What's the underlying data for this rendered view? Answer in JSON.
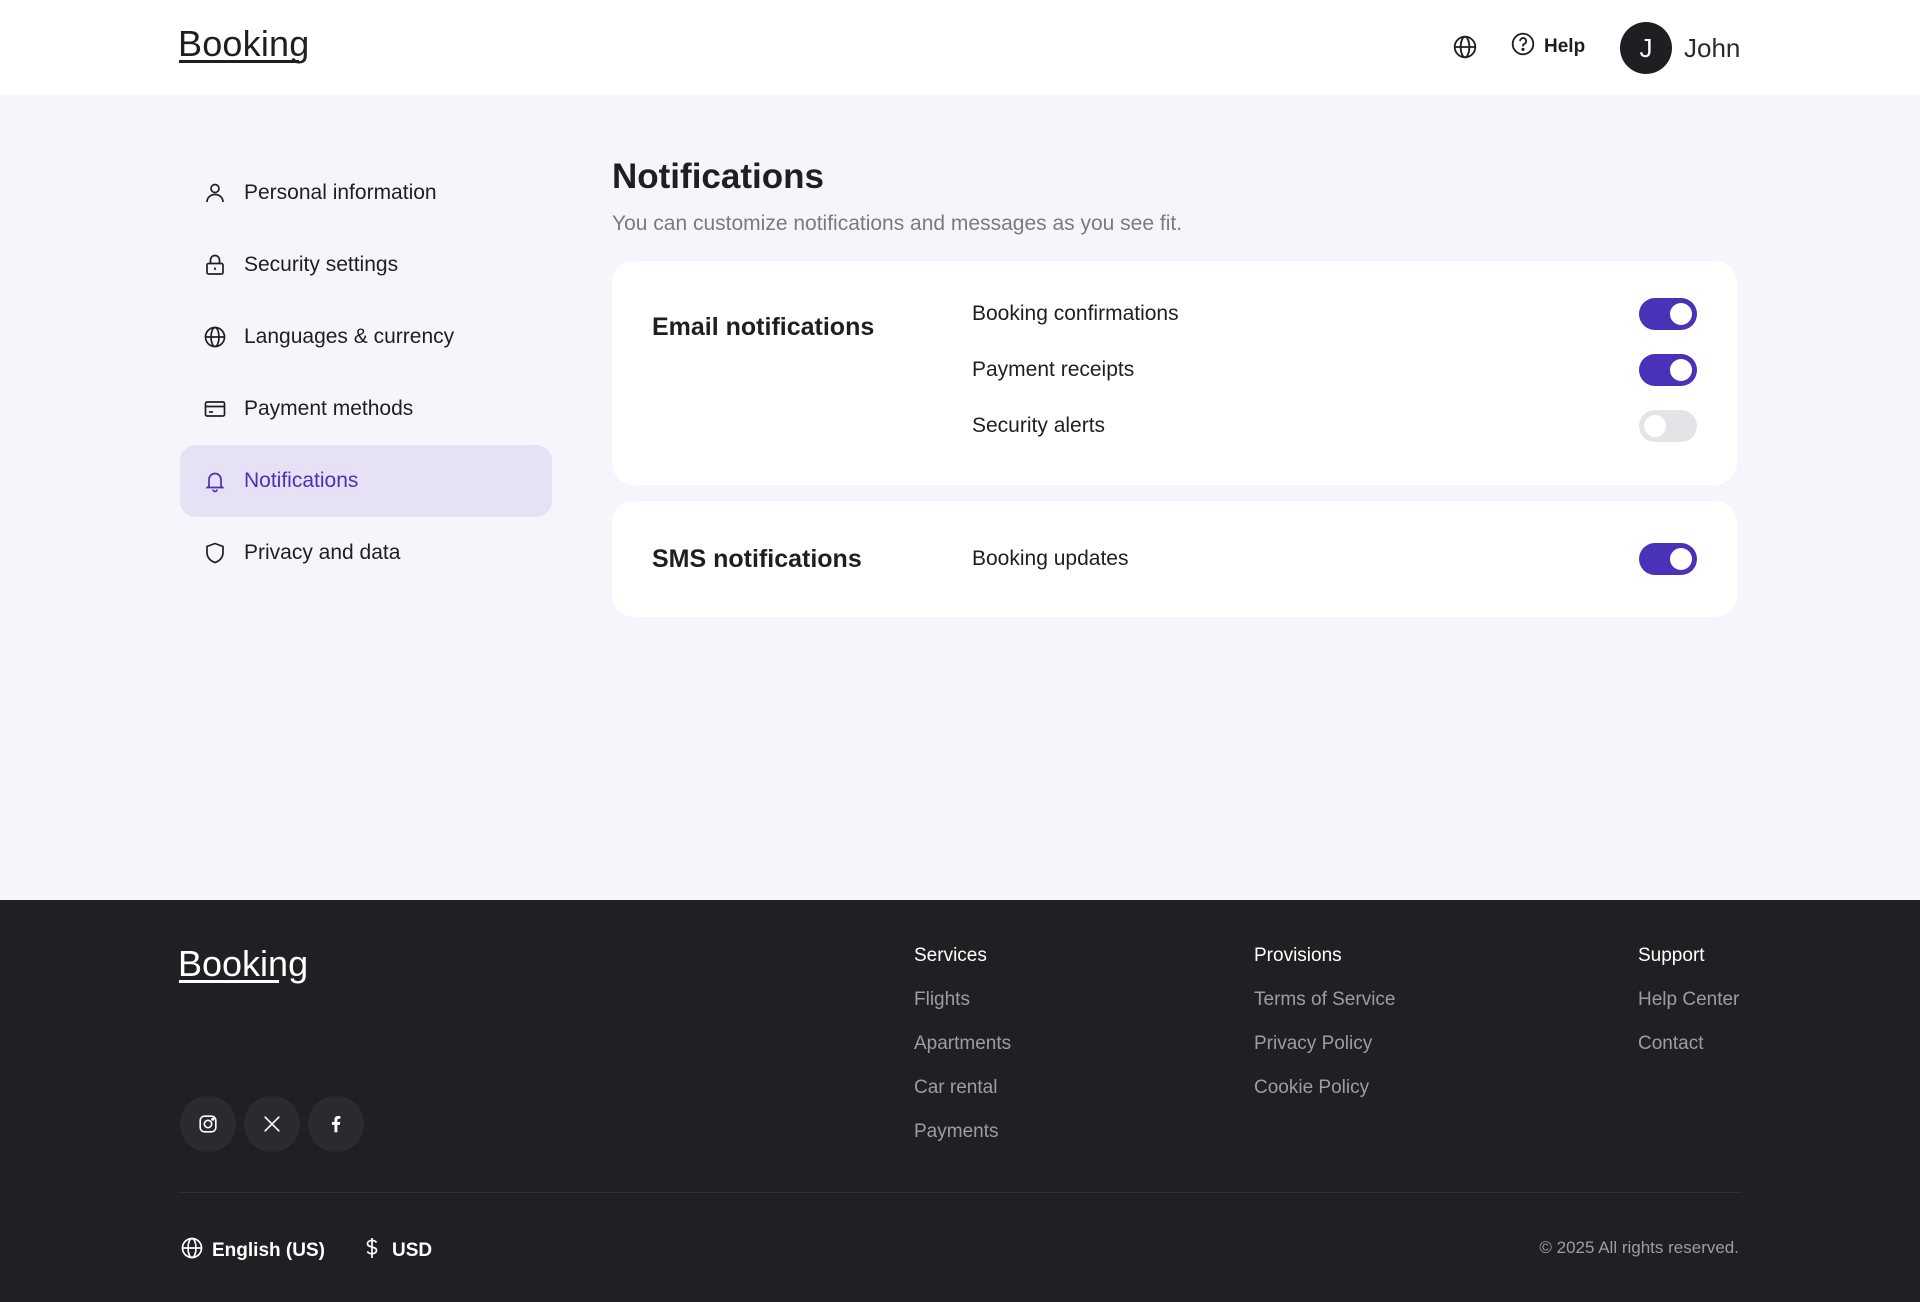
{
  "header": {
    "logo": "Booking",
    "help_label": "Help",
    "avatar_initial": "J",
    "user_name": "John",
    "globe_icon": "globe-icon",
    "help_icon": "help-circle-icon"
  },
  "sidebar": {
    "items": [
      {
        "label": "Personal information",
        "icon": "user-icon"
      },
      {
        "label": "Security settings",
        "icon": "lock-icon"
      },
      {
        "label": "Languages & currency",
        "icon": "globe-icon"
      },
      {
        "label": "Payment methods",
        "icon": "credit-card-icon"
      },
      {
        "label": "Notifications",
        "icon": "bell-icon",
        "active": true
      },
      {
        "label": "Privacy and data",
        "icon": "shield-icon"
      }
    ]
  },
  "main": {
    "title": "Notifications",
    "subtitle": "You can customize notifications and messages as you see fit.",
    "email": {
      "title": "Email notifications",
      "rows": [
        {
          "label": "Booking confirmations",
          "enabled": true
        },
        {
          "label": "Payment receipts",
          "enabled": true
        },
        {
          "label": "Security alerts",
          "enabled": false
        }
      ]
    },
    "sms": {
      "title": "SMS notifications",
      "rows": [
        {
          "label": "Booking updates",
          "enabled": true
        }
      ]
    }
  },
  "footer": {
    "logo": "Booking",
    "socials": [
      "instagram-icon",
      "x-icon",
      "facebook-icon"
    ],
    "columns": [
      {
        "title": "Services",
        "links": [
          "Flights",
          "Apartments",
          "Car rental",
          "Payments"
        ]
      },
      {
        "title": "Provisions",
        "links": [
          "Terms of Service",
          "Privacy Policy",
          "Cookie Policy"
        ]
      },
      {
        "title": "Support",
        "links": [
          "Help Center",
          "Contact"
        ]
      }
    ],
    "language": "English (US)",
    "currency": "USD",
    "copyright": "© 2025 All rights reserved."
  },
  "colors": {
    "accent": "#4a32b8",
    "active_bg": "#e6e1f4",
    "page_bg": "#f7f5fb",
    "footer_bg": "#1f2024"
  }
}
